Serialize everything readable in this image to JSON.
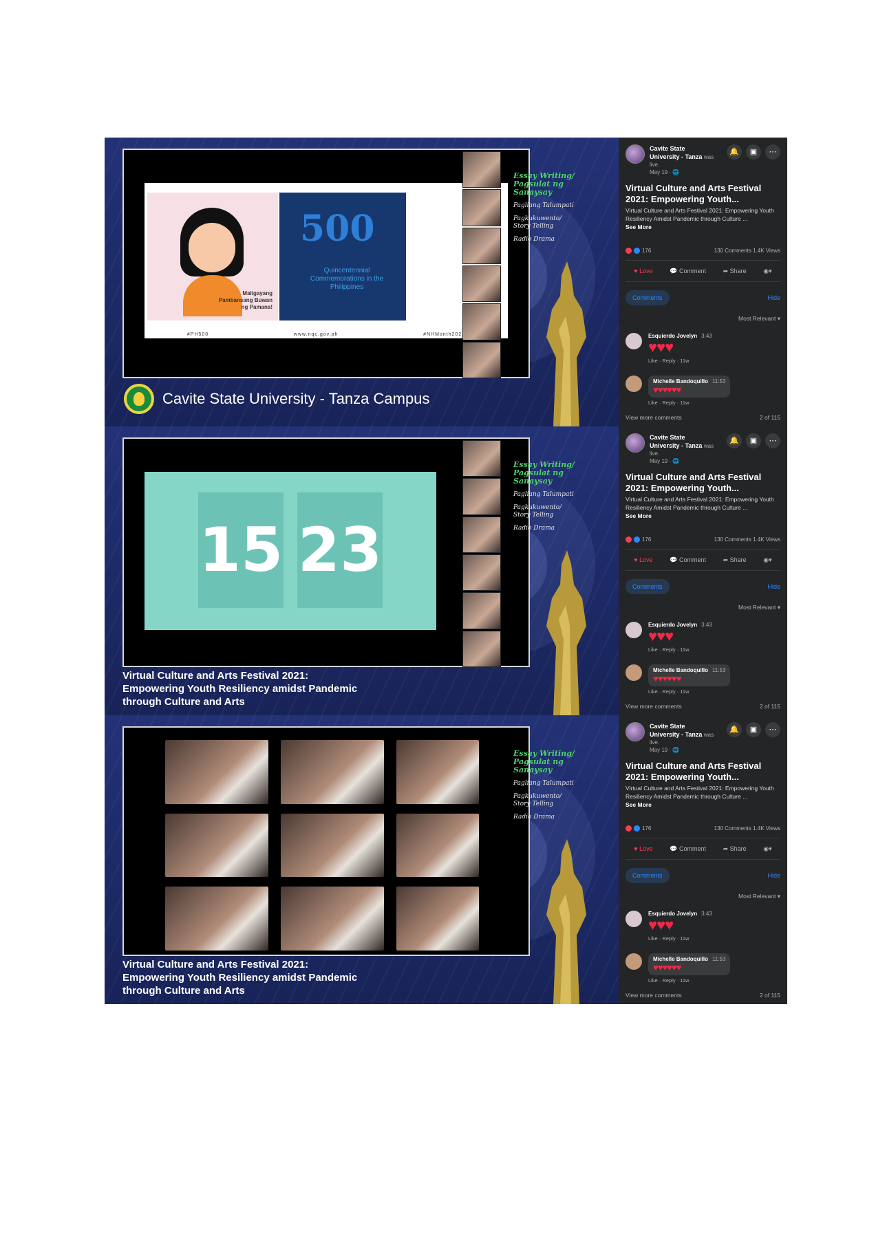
{
  "overlay": {
    "title_line1": "Essay Writing/",
    "title_line2": "Pagsulat ng Sanaysay",
    "item1": "Pagliang Talumpati",
    "item2": "Pagkukuwento/",
    "item2b": "Story Telling",
    "item3": "Radio Drama"
  },
  "panel1": {
    "campus_label": "Cavite State University - Tanza Campus",
    "slide": {
      "logo_text": "500",
      "commemoration": "Quincentennial Commemorations in the Philippines",
      "side_text": "Maligayang Pambansang Buwan ng Pamana!",
      "footer": [
        "#PH500",
        "www.nqc.gov.ph",
        "#NHMonth2021"
      ]
    }
  },
  "panel2": {
    "timer_left": "15",
    "timer_right": "23"
  },
  "banner": {
    "line1": "Virtual Culture and Arts Festival 2021:",
    "line2": "Empowering Youth Resiliency amidst Pandemic",
    "line3": "through Culture and Arts"
  },
  "fb": {
    "page_name_1": "Cavite State",
    "page_name_2": "University - Tanza",
    "was": "was",
    "live": "live.",
    "date": "May 19 · 🌐",
    "title": "Virtual Culture and Arts Festival 2021: Empowering Youth...",
    "desc": "Virtual Culture and Arts Festival 2021: Empowering Youth Resiliency Amidst Pandemic through Culture ...",
    "see_more": "See More",
    "reactions": "176",
    "comments_views": "130 Comments 1.4K Views",
    "love": "Love",
    "comment": "Comment",
    "share": "Share",
    "comments_tab": "Comments",
    "hide": "Hide",
    "most_relevant": "Most Relevant ▾",
    "c1_name": "Esquierdo Jovelyn",
    "c1_time": "3:43",
    "c1_links": "Like · Reply · 11w",
    "c2_name": "Michelle Bandoquillo",
    "c2_time": "11:53",
    "c2_links": "Like · Reply · 11w",
    "view_more": "View more comments",
    "count": "2 of 115"
  },
  "colors": {
    "stream_bg": "#1d2a66",
    "fb_bg": "#242526",
    "accent": "#2d88ff",
    "overlay_title": "#4fd16b"
  },
  "icons": [
    "bell-icon",
    "message-icon",
    "more-icon",
    "love-icon",
    "comment-icon",
    "share-icon"
  ]
}
